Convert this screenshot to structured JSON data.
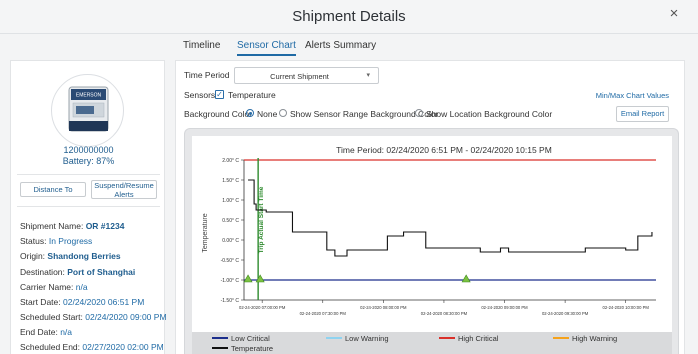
{
  "modal": {
    "title": "Shipment Details",
    "close_glyph": "×"
  },
  "tabs": [
    {
      "label": "Timeline",
      "active": false
    },
    {
      "label": "Sensor Chart",
      "active": true
    },
    {
      "label": "Alerts Summary",
      "active": false
    }
  ],
  "device": {
    "id": "1200000000",
    "battery": "Battery: 87%",
    "logo_text": "EMERSON",
    "image_icon": "temperature-tracker-device"
  },
  "buttons": {
    "distance": "Distance To",
    "suspend": "Suspend/Resume Alerts",
    "email": "Email Report"
  },
  "shipment": {
    "name_label": "Shipment Name:",
    "name_value": "OR #1234",
    "status_label": "Status:",
    "status_value": "In Progress",
    "origin_label": "Origin:",
    "origin_value": "Shandong Berries",
    "destination_label": "Destination:",
    "destination_value": "Port of Shanghai",
    "carrier_label": "Carrier Name:",
    "carrier_value": "n/a",
    "start_label": "Start Date:",
    "start_value": "02/24/2020 06:51 PM",
    "sched_start_label": "Scheduled Start:",
    "sched_start_value": "02/24/2020 09:00 PM",
    "end_label": "End Date:",
    "end_value": "n/a",
    "sched_end_label": "Scheduled End:",
    "sched_end_value": "02/27/2020 02:00 PM"
  },
  "controls": {
    "time_period_label": "Time Period",
    "time_period_value": "Current Shipment",
    "sensors_label": "Sensors",
    "sensor_checked": true,
    "sensor_name": "Temperature",
    "bg_color_label": "Background Color",
    "bg_options": [
      {
        "label": "None",
        "selected": true
      },
      {
        "label": "Show Sensor Range Background Color",
        "selected": false
      },
      {
        "label": "Show Location Background Color",
        "selected": false
      }
    ],
    "minmax_link": "Min/Max Chart Values"
  },
  "colors": {
    "accent": "#1f6aa5",
    "low_critical": "#1c2f8c",
    "low_warning": "#8fd3f0",
    "high_critical": "#d9302a",
    "high_warning": "#f5a21b",
    "temperature": "#111111",
    "trip_start": "#2e8b2e"
  },
  "chart_data": {
    "type": "line",
    "title": "Time Period: 02/24/2020 6:51 PM - 02/24/2020 10:15 PM",
    "ylabel": "Temperature",
    "ylim": [
      -1.5,
      2.0
    ],
    "yticks": [
      {
        "value": 2.0,
        "label": "2.00° C"
      },
      {
        "value": 1.5,
        "label": "1.50° C"
      },
      {
        "value": 1.0,
        "label": "1.00° C"
      },
      {
        "value": 0.5,
        "label": "0.50° C"
      },
      {
        "value": 0.0,
        "label": "0.00° C"
      },
      {
        "value": -0.5,
        "label": "-0.50° C"
      },
      {
        "value": -1.0,
        "label": "-1.00° C"
      },
      {
        "value": -1.5,
        "label": "-1.50° C"
      }
    ],
    "xlim": [
      "18:51",
      "22:15"
    ],
    "xticks": [
      {
        "time": "19:00",
        "label": "02-24-2020 07:00:00 PM",
        "row": 1
      },
      {
        "time": "19:30",
        "label": "02-24-2020 07:30:00 PM",
        "row": 2
      },
      {
        "time": "20:00",
        "label": "02-24-2020 08:00:00 PM",
        "row": 1
      },
      {
        "time": "20:30",
        "label": "02-24-2020 08:30:00 PM",
        "row": 2
      },
      {
        "time": "21:00",
        "label": "02-24-2020 09:00:00 PM",
        "row": 1
      },
      {
        "time": "21:30",
        "label": "02-24-2020 09:30:00 PM",
        "row": 2
      },
      {
        "time": "22:00",
        "label": "02-24-2020 10:00:00 PM",
        "row": 1
      }
    ],
    "thresholds": [
      {
        "name": "High Critical",
        "value": 2.0
      },
      {
        "name": "Low Critical",
        "value": -1.0
      }
    ],
    "annotations": [
      {
        "label": "Trip Actual Start Time",
        "time": "18:58"
      }
    ],
    "markers": [
      {
        "time": "18:53",
        "value": -1.0
      },
      {
        "time": "18:59",
        "value": -1.0
      },
      {
        "time": "20:41",
        "value": -1.0
      }
    ],
    "series": [
      {
        "name": "Temperature",
        "step": true,
        "points": [
          [
            "18:53",
            1.5
          ],
          [
            "18:56",
            0.9
          ],
          [
            "18:57",
            0.75
          ],
          [
            "19:02",
            0.7
          ],
          [
            "19:15",
            0.2
          ],
          [
            "19:32",
            -0.25
          ],
          [
            "19:36",
            -0.4
          ],
          [
            "19:42",
            -0.25
          ],
          [
            "20:02",
            0.1
          ],
          [
            "20:10",
            0.2
          ],
          [
            "20:17",
            0.2
          ],
          [
            "20:21",
            -0.2
          ],
          [
            "20:48",
            -0.3
          ],
          [
            "20:58",
            -0.2
          ],
          [
            "21:02",
            -0.3
          ],
          [
            "21:14",
            -0.3
          ],
          [
            "21:40",
            -0.2
          ],
          [
            "21:50",
            -0.2
          ],
          [
            "22:00",
            -0.25
          ],
          [
            "22:06",
            0.1
          ],
          [
            "22:13",
            0.2
          ]
        ]
      }
    ],
    "legend": [
      {
        "name": "Low Critical",
        "color": "#1c2f8c"
      },
      {
        "name": "Low Warning",
        "color": "#8fd3f0"
      },
      {
        "name": "High Critical",
        "color": "#d9302a"
      },
      {
        "name": "High Warning",
        "color": "#f5a21b"
      },
      {
        "name": "Temperature",
        "color": "#111111"
      }
    ],
    "legend_position": "bottom",
    "grid": false
  }
}
